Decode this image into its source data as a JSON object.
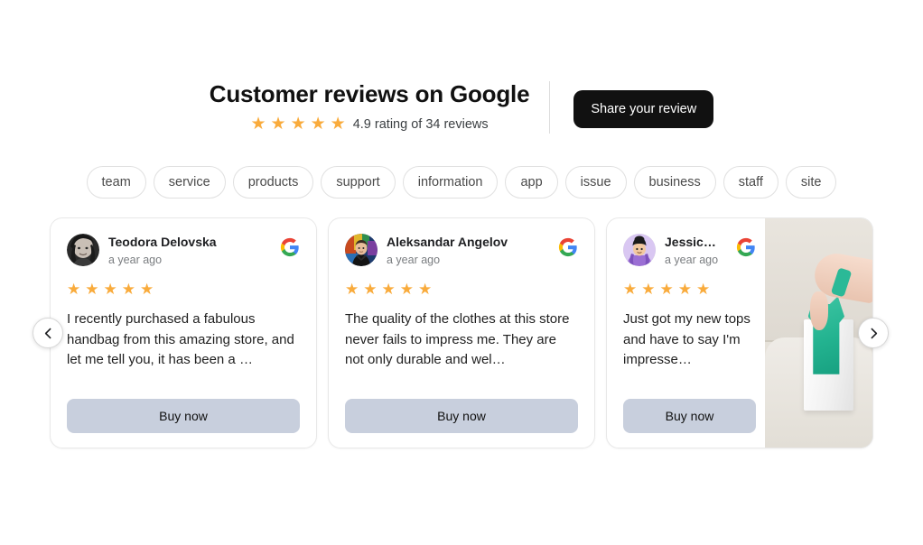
{
  "header": {
    "title": "Customer reviews on Google",
    "stars": 5,
    "rating_text": "4.9 rating of 34 reviews",
    "share_button": "Share your review",
    "star_color": "#f9ab3c"
  },
  "tags": [
    {
      "label": "team"
    },
    {
      "label": "service"
    },
    {
      "label": "products"
    },
    {
      "label": "support"
    },
    {
      "label": "information"
    },
    {
      "label": "app"
    },
    {
      "label": "issue"
    },
    {
      "label": "business"
    },
    {
      "label": "staff"
    },
    {
      "label": "site"
    }
  ],
  "carousel": {
    "prev_icon": "chevron-left-icon",
    "next_icon": "chevron-right-icon",
    "cards": [
      {
        "name": "Teodora Delovska",
        "date": "a year ago",
        "source_icon": "google-icon",
        "stars": 5,
        "text": "I recently purchased a fabulous handbag from this amazing store, and let me tell you, it has been a …",
        "cta": "Buy now",
        "has_photo": false
      },
      {
        "name": "Aleksandar Angelov",
        "date": "a year ago",
        "source_icon": "google-icon",
        "stars": 5,
        "text": "The quality of the clothes at this store never fails to impress me. They are not only durable and wel…",
        "cta": "Buy now",
        "has_photo": false
      },
      {
        "name": "Jessic…",
        "date": "a year ago",
        "source_icon": "google-icon",
        "stars": 5,
        "text": "Just got my new tops and have to say I'm impresse…",
        "cta": "Buy now",
        "has_photo": true,
        "photo_alt": "hand placing teal garment into white paper shopping bag on a beige sofa"
      }
    ]
  },
  "colors": {
    "accent_star": "#f9ab3c",
    "cta_background": "#c8cfdd",
    "share_background": "#111111",
    "card_border": "#e8e8e8"
  }
}
